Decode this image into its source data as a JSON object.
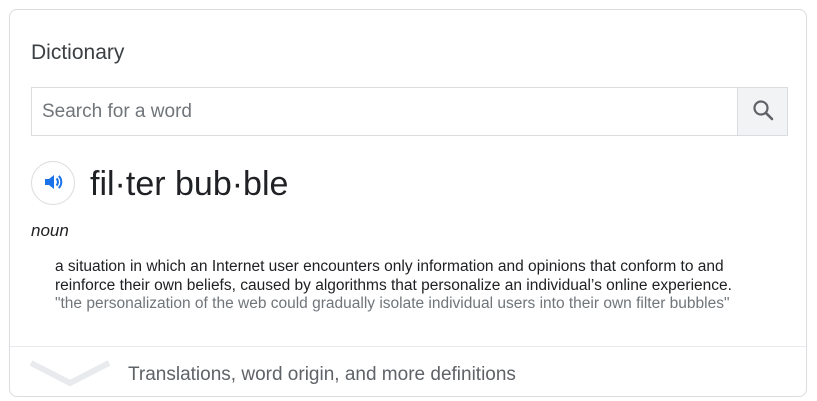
{
  "card": {
    "title": "Dictionary"
  },
  "search": {
    "placeholder": "Search for a word",
    "value": "",
    "button_icon": "search-icon"
  },
  "entry": {
    "speaker_icon": "speaker-icon",
    "headword": "fil·ter bub·ble",
    "part_of_speech": "noun",
    "definition": "a situation in which an Internet user encounters only information and opinions that conform to and reinforce their own beliefs, caused by algorithms that personalize an individual’s online experience.",
    "example": "\"the personalization of the web could gradually isolate individual users into their own filter bubbles\""
  },
  "footer": {
    "expand_icon": "chevron-down-icon",
    "more_label": "Translations, word origin, and more definitions"
  },
  "colors": {
    "accent_blue": "#1a73e8",
    "border": "#dadce0",
    "text_primary": "#202124",
    "text_secondary": "#70757a"
  }
}
